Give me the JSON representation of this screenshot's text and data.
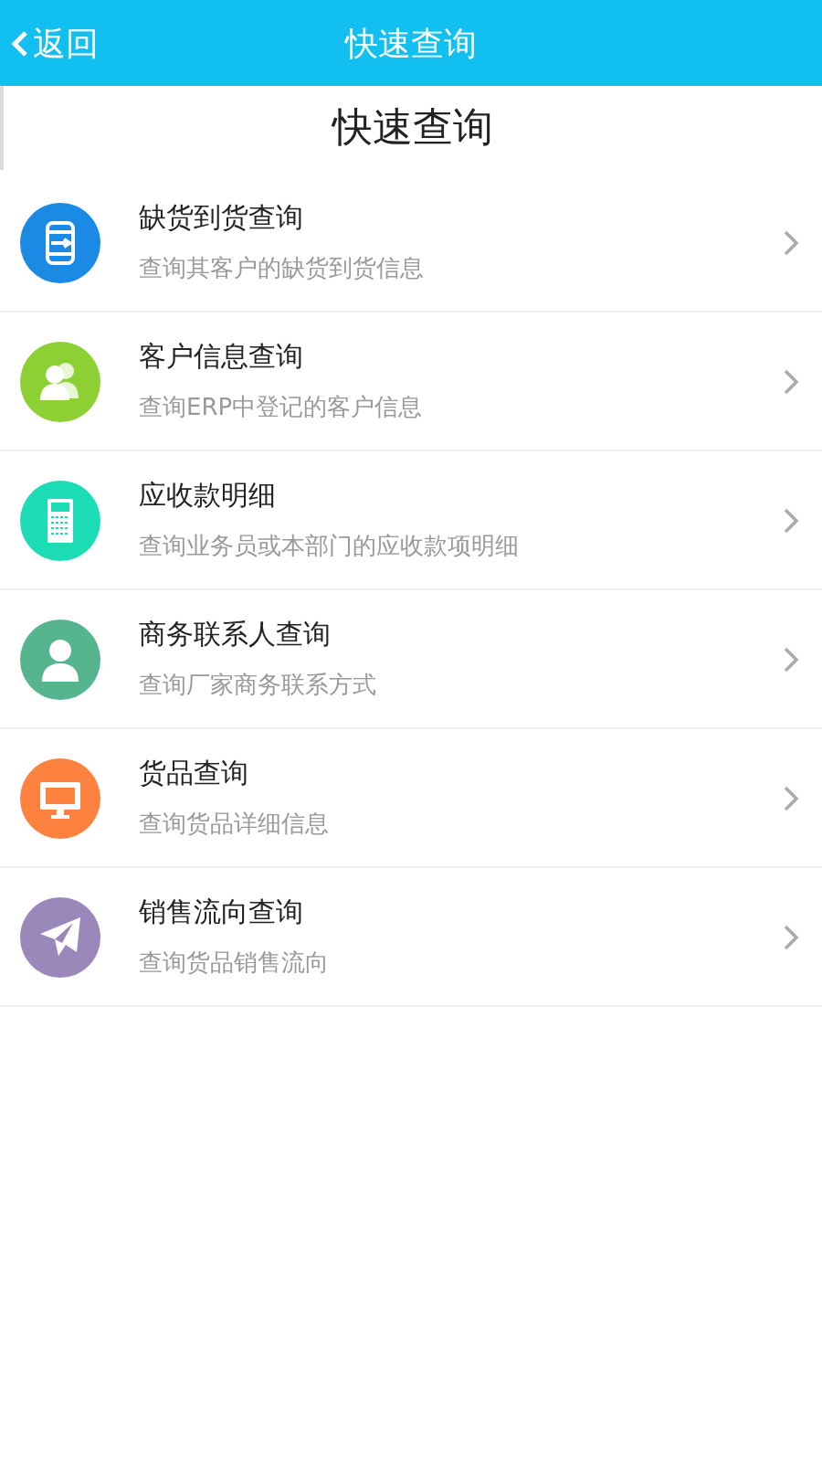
{
  "header": {
    "back": "返回",
    "title": "快速查询"
  },
  "page_title": "快速查询",
  "items": [
    {
      "kind": "can",
      "color": "#1a8ae4",
      "title": "缺货到货查询",
      "subtitle": "查询其客户的缺货到货信息"
    },
    {
      "kind": "users",
      "color": "#8cd034",
      "title": "客户信息查询",
      "subtitle": "查询ERP中登记的客户信息"
    },
    {
      "kind": "calculator",
      "color": "#1cdcb6",
      "title": "应收款明细",
      "subtitle": "查询业务员或本部门的应收款项明细"
    },
    {
      "kind": "user",
      "color": "#56b48e",
      "title": "商务联系人查询",
      "subtitle": "查询厂家商务联系方式"
    },
    {
      "kind": "monitor",
      "color": "#fd8240",
      "title": "货品查询",
      "subtitle": "查询货品详细信息"
    },
    {
      "kind": "plane",
      "color": "#9a88bb",
      "title": "销售流向查询",
      "subtitle": "查询货品销售流向"
    }
  ]
}
